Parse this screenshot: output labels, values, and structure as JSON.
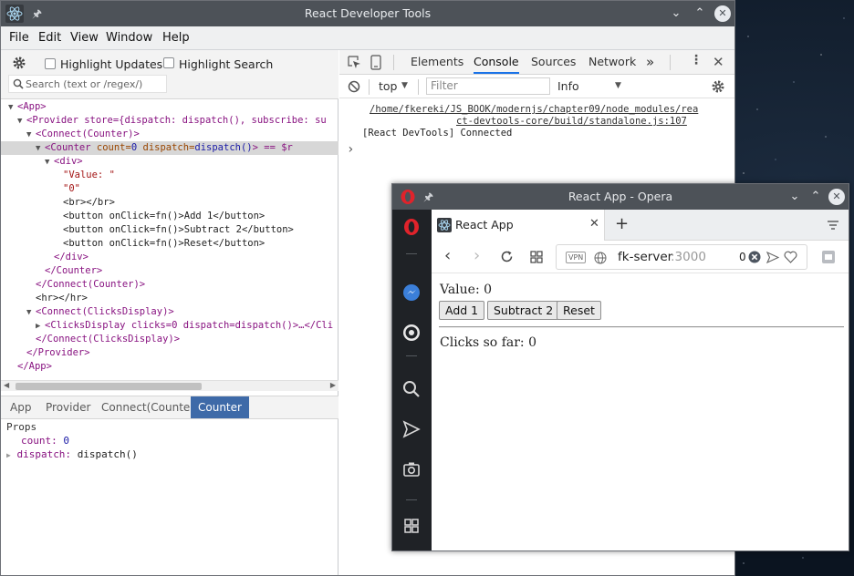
{
  "main_window": {
    "title": "React Developer Tools",
    "menu": [
      "File",
      "Edit",
      "View",
      "Window",
      "Help"
    ]
  },
  "react_devtools": {
    "toolbar": {
      "highlight_updates": "Highlight Updates",
      "highlight_search": "Highlight Search",
      "search_placeholder": "Search (text or /regex/)"
    },
    "tree": {
      "app_open": "<App>",
      "provider_open": "<Provider store={dispatch: dispatch(), subscribe: su",
      "connect_counter_open": "<Connect(Counter)>",
      "counter_tag": "<Counter",
      "counter_attr_count": " count=",
      "counter_attr_count_val": "0",
      "counter_attr_dispatch": " dispatch=",
      "counter_attr_dispatch_val": "dispatch()",
      "counter_tail": "> == $r",
      "div_open": "<div>",
      "value_text": "\"Value: \"",
      "zero_text": "\"0\"",
      "br": "<br></br>",
      "btn_add": "<button onClick=fn()>Add 1</button>",
      "btn_sub": "<button onClick=fn()>Subtract 2</button>",
      "btn_reset": "<button onClick=fn()>Reset</button>",
      "div_close": "</div>",
      "counter_close": "</Counter>",
      "connect_counter_close": "</Connect(Counter)>",
      "hr": "<hr></hr>",
      "connect_clicks_open": "<Connect(ClicksDisplay)>",
      "clicks_row": "<ClicksDisplay clicks=0 dispatch=dispatch()>…</Cli",
      "connect_clicks_close": "</Connect(ClicksDisplay)>",
      "provider_close": "</Provider>",
      "app_close": "</App>"
    },
    "breadcrumbs": [
      "App",
      "Provider",
      "Connect(Counter)",
      "Counter"
    ],
    "props": {
      "header": "Props",
      "count_key": "count:",
      "count_val": "0",
      "dispatch_key": "dispatch:",
      "dispatch_val": "dispatch()"
    }
  },
  "console": {
    "tabs": [
      "Elements",
      "Console",
      "Sources",
      "Network"
    ],
    "more": "»",
    "context": "top",
    "filter_placeholder": "Filter",
    "level": "Info",
    "source_line1": "/home/fkereki/JS_BOOK/modernjs/chapter09/node_modules/rea",
    "source_line2": "ct-devtools-core/build/standalone.js:107",
    "message": "[React DevTools] Connected",
    "prompt": "›"
  },
  "opera_window": {
    "title": "React App - Opera",
    "tab_title": "React App",
    "new_tab": "+",
    "vpn": "VPN",
    "address_host": "fk-server",
    "address_port": ":3000",
    "badge_count": "0"
  },
  "react_app": {
    "value_label": "Value: 0",
    "add_button": "Add 1",
    "subtract_button": "Subtract 2",
    "reset_button": "Reset",
    "clicks_label": "Clicks so far: 0"
  },
  "colors": {
    "titlebar": "#4d5258",
    "active_crumb": "#3e6aa8",
    "tag": "#881280",
    "attr_name": "#994500",
    "attr_value": "#1a1aa6"
  }
}
